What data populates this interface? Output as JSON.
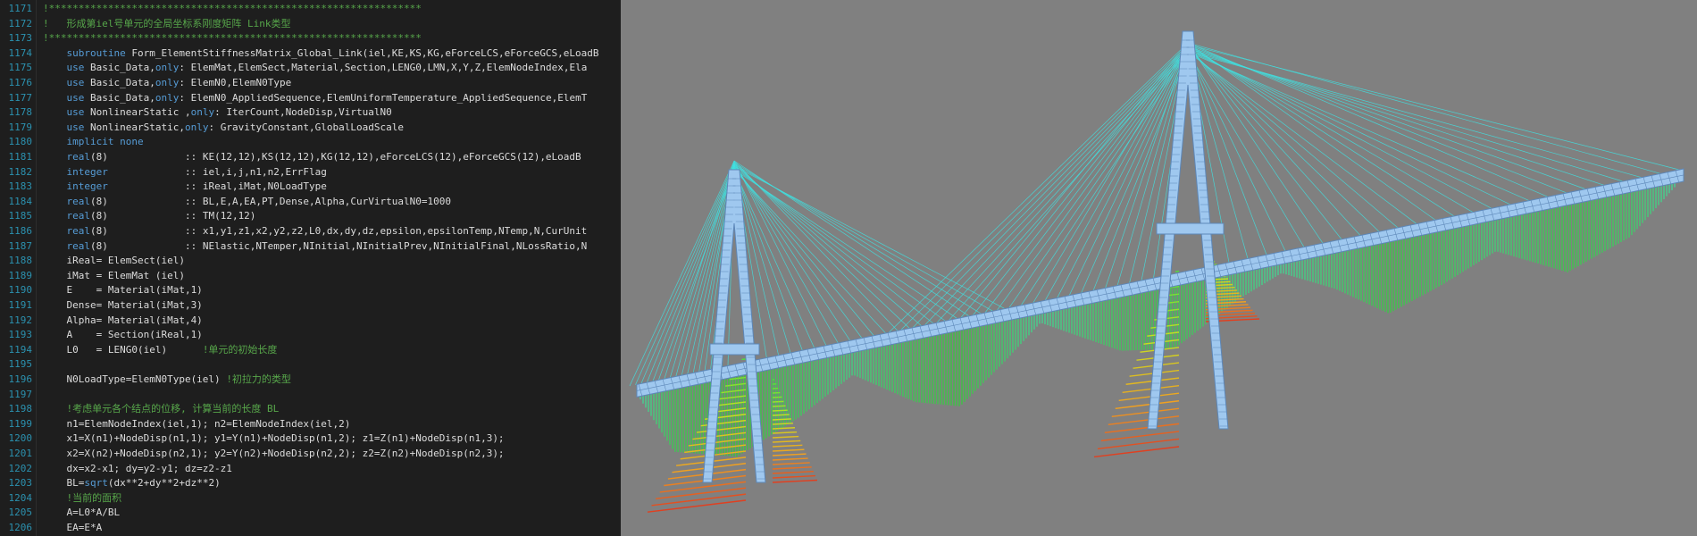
{
  "editor": {
    "lines": [
      {
        "num": "1171",
        "tokens": [
          {
            "t": "!***************************************************************",
            "c": "comment"
          }
        ]
      },
      {
        "num": "1172",
        "tokens": [
          {
            "t": "!   形成第iel号单元的全局坐标系刚度矩阵 Link类型",
            "c": "comment"
          }
        ]
      },
      {
        "num": "1173",
        "tokens": [
          {
            "t": "!***************************************************************",
            "c": "comment"
          }
        ]
      },
      {
        "num": "1174",
        "tokens": [
          {
            "t": "    ",
            "c": "plain"
          },
          {
            "t": "subroutine",
            "c": "keyword"
          },
          {
            "t": " Form_ElementStiffnessMatrix_Global_Link(iel,KE,KS,KG,eForceLCS,eForceGCS,eLoadB",
            "c": "plain"
          }
        ]
      },
      {
        "num": "1175",
        "tokens": [
          {
            "t": "    ",
            "c": "plain"
          },
          {
            "t": "use",
            "c": "keyword"
          },
          {
            "t": " Basic_Data,",
            "c": "plain"
          },
          {
            "t": "only",
            "c": "keyword"
          },
          {
            "t": ": ElemMat,ElemSect,Material,Section,LENG0,LMN,X,Y,Z,ElemNodeIndex,Ela",
            "c": "plain"
          }
        ]
      },
      {
        "num": "1176",
        "tokens": [
          {
            "t": "    ",
            "c": "plain"
          },
          {
            "t": "use",
            "c": "keyword"
          },
          {
            "t": " Basic_Data,",
            "c": "plain"
          },
          {
            "t": "only",
            "c": "keyword"
          },
          {
            "t": ": ElemN0,ElemN0Type",
            "c": "plain"
          }
        ]
      },
      {
        "num": "1177",
        "tokens": [
          {
            "t": "    ",
            "c": "plain"
          },
          {
            "t": "use",
            "c": "keyword"
          },
          {
            "t": " Basic_Data,",
            "c": "plain"
          },
          {
            "t": "only",
            "c": "keyword"
          },
          {
            "t": ": ElemN0_AppliedSequence,ElemUniformTemperature_AppliedSequence,ElemT",
            "c": "plain"
          }
        ]
      },
      {
        "num": "1178",
        "tokens": [
          {
            "t": "    ",
            "c": "plain"
          },
          {
            "t": "use",
            "c": "keyword"
          },
          {
            "t": " NonlinearStatic ,",
            "c": "plain"
          },
          {
            "t": "only",
            "c": "keyword"
          },
          {
            "t": ": IterCount,NodeDisp,VirtualN0",
            "c": "plain"
          }
        ]
      },
      {
        "num": "1179",
        "tokens": [
          {
            "t": "    ",
            "c": "plain"
          },
          {
            "t": "use",
            "c": "keyword"
          },
          {
            "t": " NonlinearStatic,",
            "c": "plain"
          },
          {
            "t": "only",
            "c": "keyword"
          },
          {
            "t": ": GravityConstant,GlobalLoadScale",
            "c": "plain"
          }
        ]
      },
      {
        "num": "1180",
        "tokens": [
          {
            "t": "    ",
            "c": "plain"
          },
          {
            "t": "implicit none",
            "c": "keyword"
          }
        ]
      },
      {
        "num": "1181",
        "tokens": [
          {
            "t": "    ",
            "c": "plain"
          },
          {
            "t": "real",
            "c": "keyword"
          },
          {
            "t": "(8)             :: KE(12,12),KS(12,12),KG(12,12),eForceLCS(12),eForceGCS(12),eLoadB",
            "c": "plain"
          }
        ]
      },
      {
        "num": "1182",
        "tokens": [
          {
            "t": "    ",
            "c": "plain"
          },
          {
            "t": "integer",
            "c": "keyword"
          },
          {
            "t": "             :: iel,i,j,n1,n2,ErrFlag",
            "c": "plain"
          }
        ]
      },
      {
        "num": "1183",
        "tokens": [
          {
            "t": "    ",
            "c": "plain"
          },
          {
            "t": "integer",
            "c": "keyword"
          },
          {
            "t": "             :: iReal,iMat,N0LoadType",
            "c": "plain"
          }
        ]
      },
      {
        "num": "1184",
        "tokens": [
          {
            "t": "    ",
            "c": "plain"
          },
          {
            "t": "real",
            "c": "keyword"
          },
          {
            "t": "(8)             :: BL,E,A,EA,PT,Dense,Alpha,CurVirtualN0=1000",
            "c": "plain"
          }
        ]
      },
      {
        "num": "1185",
        "tokens": [
          {
            "t": "    ",
            "c": "plain"
          },
          {
            "t": "real",
            "c": "keyword"
          },
          {
            "t": "(8)             :: TM(12,12)",
            "c": "plain"
          }
        ]
      },
      {
        "num": "1186",
        "tokens": [
          {
            "t": "    ",
            "c": "plain"
          },
          {
            "t": "real",
            "c": "keyword"
          },
          {
            "t": "(8)             :: x1,y1,z1,x2,y2,z2,L0,dx,dy,dz,epsilon,epsilonTemp,NTemp,N,CurUnit",
            "c": "plain"
          }
        ]
      },
      {
        "num": "1187",
        "tokens": [
          {
            "t": "    ",
            "c": "plain"
          },
          {
            "t": "real",
            "c": "keyword"
          },
          {
            "t": "(8)             :: NElastic,NTemper,NInitial,NInitialPrev,NInitialFinal,NLossRatio,N",
            "c": "plain"
          }
        ]
      },
      {
        "num": "1188",
        "tokens": [
          {
            "t": "    iReal= ElemSect(iel)",
            "c": "plain"
          }
        ]
      },
      {
        "num": "1189",
        "tokens": [
          {
            "t": "    iMat = ElemMat (iel)",
            "c": "plain"
          }
        ]
      },
      {
        "num": "1190",
        "tokens": [
          {
            "t": "    E    = Material(iMat,1)",
            "c": "plain"
          }
        ]
      },
      {
        "num": "1191",
        "tokens": [
          {
            "t": "    Dense= Material(iMat,3)",
            "c": "plain"
          }
        ]
      },
      {
        "num": "1192",
        "tokens": [
          {
            "t": "    Alpha= Material(iMat,4)",
            "c": "plain"
          }
        ]
      },
      {
        "num": "1193",
        "tokens": [
          {
            "t": "    A    = Section(iReal,1)",
            "c": "plain"
          }
        ]
      },
      {
        "num": "1194",
        "tokens": [
          {
            "t": "    L0   = LENG0(iel)      ",
            "c": "plain"
          },
          {
            "t": "!单元的初始长度",
            "c": "comment"
          }
        ]
      },
      {
        "num": "1195",
        "tokens": [
          {
            "t": "",
            "c": "plain"
          }
        ]
      },
      {
        "num": "1196",
        "tokens": [
          {
            "t": "    N0LoadType=ElemN0Type(iel) ",
            "c": "plain"
          },
          {
            "t": "!初拉力的类型",
            "c": "comment"
          }
        ]
      },
      {
        "num": "1197",
        "tokens": [
          {
            "t": "",
            "c": "plain"
          }
        ]
      },
      {
        "num": "1198",
        "tokens": [
          {
            "t": "    ",
            "c": "plain"
          },
          {
            "t": "!考虑单元各个结点的位移, 计算当前的长度 BL",
            "c": "comment"
          }
        ]
      },
      {
        "num": "1199",
        "tokens": [
          {
            "t": "    n1=ElemNodeIndex(iel,1); n2=ElemNodeIndex(iel,2)",
            "c": "plain"
          }
        ]
      },
      {
        "num": "1200",
        "tokens": [
          {
            "t": "    x1=X(n1)+NodeDisp(n1,1); y1=Y(n1)+NodeDisp(n1,2); z1=Z(n1)+NodeDisp(n1,3);",
            "c": "plain"
          }
        ]
      },
      {
        "num": "1201",
        "tokens": [
          {
            "t": "    x2=X(n2)+NodeDisp(n2,1); y2=Y(n2)+NodeDisp(n2,2); z2=Z(n2)+NodeDisp(n2,3);",
            "c": "plain"
          }
        ]
      },
      {
        "num": "1202",
        "tokens": [
          {
            "t": "    dx=x2-x1; dy=y2-y1; dz=z2-z1",
            "c": "plain"
          }
        ]
      },
      {
        "num": "1203",
        "tokens": [
          {
            "t": "    BL=",
            "c": "plain"
          },
          {
            "t": "sqrt",
            "c": "builtin"
          },
          {
            "t": "(dx**2+dy**2+dz**2)",
            "c": "plain"
          }
        ]
      },
      {
        "num": "1204",
        "tokens": [
          {
            "t": "    ",
            "c": "plain"
          },
          {
            "t": "!当前的面积",
            "c": "comment"
          }
        ]
      },
      {
        "num": "1205",
        "tokens": [
          {
            "t": "    A=L0*A/BL",
            "c": "plain"
          }
        ]
      },
      {
        "num": "1206",
        "tokens": [
          {
            "t": "    EA=E*A",
            "c": "plain"
          }
        ]
      }
    ]
  },
  "viewport": {
    "background": "#808080",
    "colors": {
      "structure": "#9fc8ef",
      "structure_edge": "#5d87b8",
      "cable": "#3fe0e0",
      "hot": "#e04020",
      "warm": "#f0a020",
      "mid": "#c8e020",
      "cool": "#30d030"
    }
  }
}
